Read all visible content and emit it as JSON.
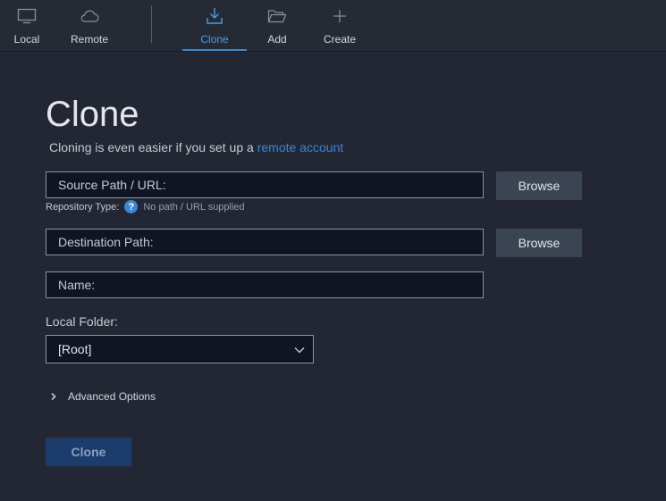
{
  "toolbar": {
    "items": [
      {
        "label": "Local",
        "icon": "monitor-icon"
      },
      {
        "label": "Remote",
        "icon": "cloud-icon"
      },
      {
        "label": "Clone",
        "icon": "download-icon",
        "active": true
      },
      {
        "label": "Add",
        "icon": "folder-open-icon"
      },
      {
        "label": "Create",
        "icon": "plus-icon"
      }
    ]
  },
  "page": {
    "title": "Clone",
    "subtitle_text": "Cloning is even easier if you set up a ",
    "subtitle_link": "remote account"
  },
  "form": {
    "source_placeholder": "Source Path / URL:",
    "browse_label": "Browse",
    "repo_type_label": "Repository Type:",
    "repo_type_help": "?",
    "repo_type_value": "No path / URL supplied",
    "destination_placeholder": "Destination Path:",
    "name_placeholder": "Name:",
    "local_folder_label": "Local Folder:",
    "local_folder_value": "[Root]",
    "advanced_options_label": "Advanced Options",
    "clone_button_label": "Clone"
  },
  "colors": {
    "background": "#222733",
    "accent": "#3e86d4",
    "field_bg": "#0f1522",
    "button_bg": "#3a4452",
    "primary_button_bg": "#1d3c6e"
  }
}
